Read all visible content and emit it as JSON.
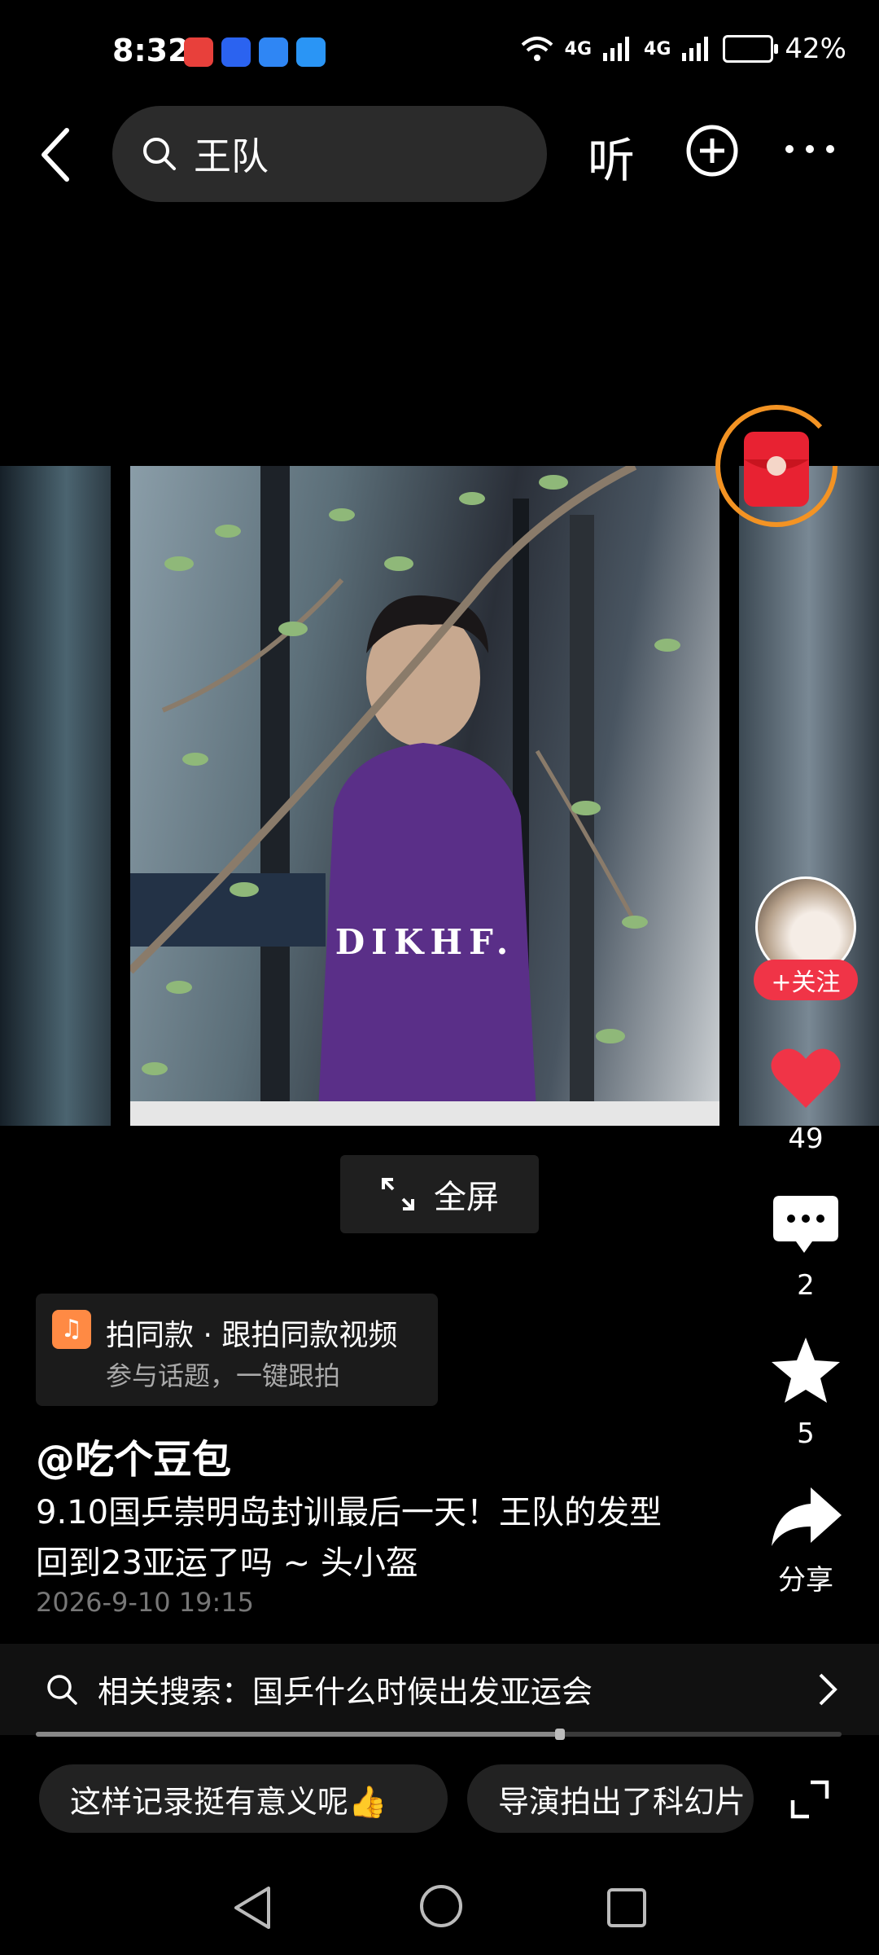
{
  "status_bar": {
    "time": "8:32",
    "network_1": "4G",
    "network_2": "4G",
    "battery": "42%"
  },
  "top_bar": {
    "search_query": "王队",
    "listen_label": "听"
  },
  "video": {
    "watermark": "DIKHF.",
    "fullscreen_label": "全屏"
  },
  "right_rail": {
    "follow_label": "+关注",
    "likes": "49",
    "comments": "2",
    "favorites": "5",
    "share_label": "分享"
  },
  "music": {
    "title": "拍同款 · 跟拍同款视频",
    "subtitle": "参与话题，一键跟拍",
    "icon": "♫"
  },
  "post": {
    "author": "@吃个豆包",
    "caption": "9.10国乒崇明岛封训最后一天！王队的发型回到23亚运了吗 ~ 头小盔",
    "time": "2026-9-10 19:15",
    "progress": 0.65
  },
  "related": {
    "text": "相关搜索：国乒什么时候出发亚运会"
  },
  "chips": [
    {
      "label": "这样记录挺有意义呢👍"
    },
    {
      "label": "导演拍出了科幻片"
    }
  ],
  "colors": {
    "accent": "#f03447",
    "ring": "#f39323"
  }
}
